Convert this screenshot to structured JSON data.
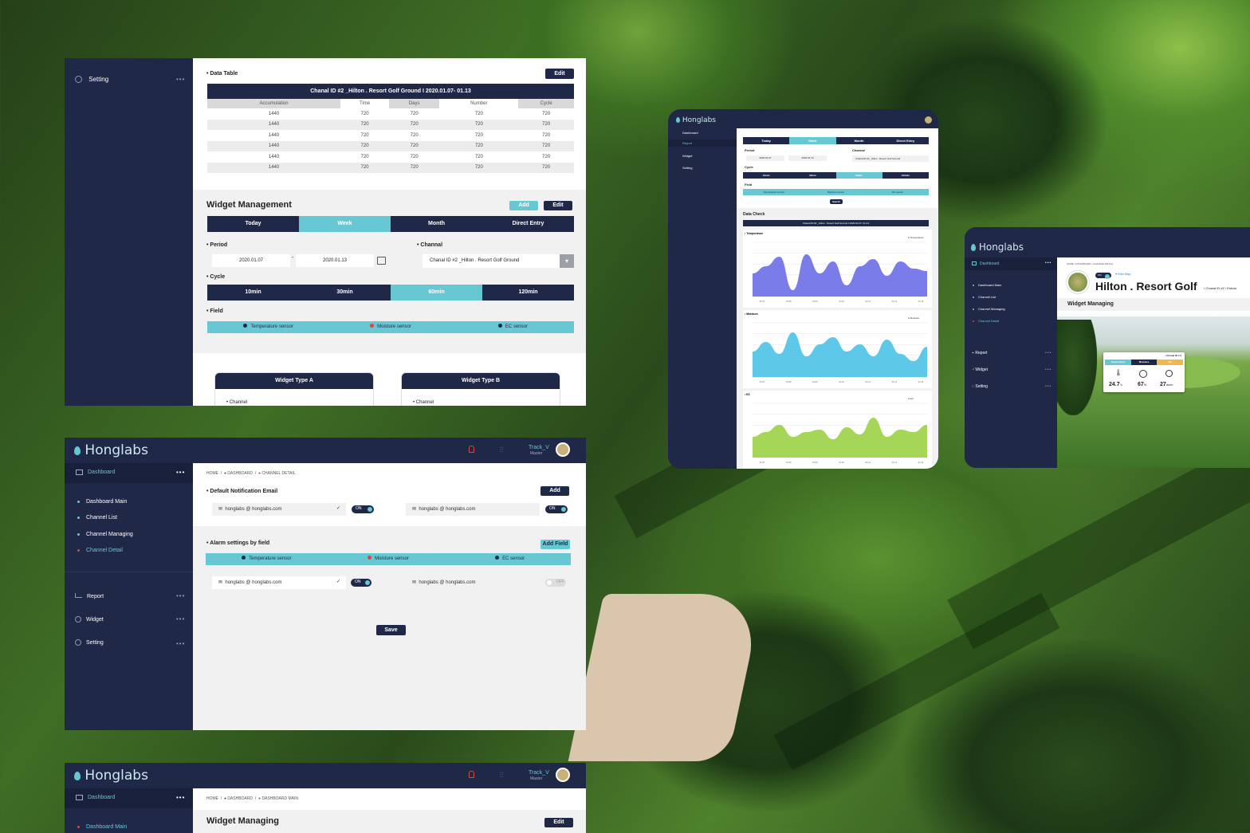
{
  "background": {
    "description_colors": [
      "#2b4a1b",
      "#5b9230"
    ]
  },
  "colors": {
    "navy": "#1f2847",
    "teal": "#67c7d3",
    "red": "#e2443c",
    "chart_purple": "#6b6ee8",
    "chart_blue": "#4cc2e6",
    "chart_green": "#9bd146"
  },
  "panel1": {
    "sidebar_setting": "Setting",
    "data_table_label": "Data Table",
    "edit": "Edit",
    "table_title": "Chanal ID #2 _Hilton . Resort Golf Ground  I    2020.01.07- 01.13",
    "columns": [
      "Accumulation",
      "Time",
      "Days",
      "Number",
      "Cycle"
    ],
    "rows": [
      [
        "1440",
        "720",
        "720",
        "720",
        "720"
      ],
      [
        "1440",
        "720",
        "720",
        "720",
        "720"
      ],
      [
        "1440",
        "720",
        "720",
        "720",
        "720"
      ],
      [
        "1440",
        "720",
        "720",
        "720",
        "720"
      ],
      [
        "1440",
        "720",
        "720",
        "720",
        "720"
      ],
      [
        "1440",
        "720",
        "720",
        "720",
        "720"
      ]
    ],
    "widget_mgmt_title": "Widget Management",
    "add": "Add",
    "edit2": "Edit",
    "period_tabs": [
      "Today",
      "Week",
      "Month",
      "Direct Entry"
    ],
    "period_label": "Period",
    "date_from": "2020.01.07",
    "date_to": "2020.01.13",
    "channel_label": "Channal",
    "channel_value": "Chanal ID #2 _Hilton . Resort Golf Ground",
    "cycle_label": "Cycle",
    "cycles": [
      "10min",
      "30min",
      "60min",
      "120min"
    ],
    "field_label": "Field",
    "fields": [
      "Temperature sensor",
      "Moisture sensor",
      "EC sensor"
    ],
    "widget_a": "Widget Type A",
    "widget_b": "Widget Type B",
    "channel_bullet": "Channel"
  },
  "panel2": {
    "logo": "Honglabs",
    "user": "Track_V",
    "role": "Master",
    "nav": {
      "dashboard": "Dashboard",
      "items": [
        "Dashboard Main",
        "Channel List",
        "Channel Managing",
        "Channel Detail"
      ],
      "report": "Report",
      "widget": "Widget",
      "setting": "Setting"
    },
    "breadcrumb": [
      "HOME",
      "DASHBOARD",
      "CHANNEL DETAIL"
    ],
    "notif_title": "Default Notification Email",
    "add": "Add",
    "email": "honglabs @ honglabs.com",
    "on": "ON",
    "off": "OFF",
    "alarm_title": "Alarm settings by field",
    "add_field": "Add Field",
    "fields": [
      "Temperature sensor",
      "Moisture sensor",
      "EC sensor"
    ],
    "save": "Save"
  },
  "panel3": {
    "logo": "Honglabs",
    "user": "Track_V",
    "role": "Master",
    "dashboard": "Dashboard",
    "dashboard_main": "Dashboard Main",
    "breadcrumb": [
      "HOME",
      "DASHBOARD",
      "DASHBOARD MAIN"
    ],
    "title": "Widget Managing",
    "edit": "Edit"
  },
  "tablet1": {
    "logo": "Honglabs",
    "nav": [
      "Dashboard",
      "Report",
      "Widget",
      "Setting"
    ],
    "tabs": [
      "Today",
      "Week",
      "Month",
      "Direct Entry"
    ],
    "period": "Period",
    "channel": "Channal",
    "date_from": "2020.01.07",
    "date_to": "2020.01.13",
    "channel_value": "Chanal ID #2 _Hilton . Resort Golf Ground",
    "cycle": "Cycle",
    "cycles": [
      "10min",
      "30min",
      "60min",
      "120min"
    ],
    "field": "Field",
    "fields": [
      "Temperature sensor",
      "Moisture sensor",
      "EC sensor"
    ],
    "search": "Search",
    "data_check": "Data Check",
    "data_title": "Chanal ID #2 _Hilton . Resort Golf Ground  I   2020.01.07- 01.13",
    "charts": [
      {
        "label": "Temperature",
        "legend": "Temperature"
      },
      {
        "label": "Moisture",
        "legend": "Moisture"
      },
      {
        "label": "EC",
        "legend": "EC"
      }
    ],
    "x_ticks": [
      "01.07",
      "01.08",
      "01.09",
      "01.10",
      "01.11",
      "01.12",
      "01.13"
    ]
  },
  "tablet2": {
    "logo": "Honglabs",
    "nav": {
      "dashboard": "Dashboard",
      "items": [
        "Dashboard Main",
        "Channel List",
        "Channel Managing",
        "Channel Detail"
      ],
      "report": "Report",
      "widget": "Widget",
      "setting": "Setting"
    },
    "breadcrumb": [
      "HOME",
      "DASHBOARD",
      "CHANNEL DETAIL"
    ],
    "on": "ON",
    "mini_map": "Mini Map",
    "title": "Hilton . Resort Golf",
    "channel_tag": "Chanal ID #2",
    "entrance": "Entran",
    "widget_managing": "Widget Managing",
    "widget": {
      "channel": "Chanal ID # 2",
      "tabs": [
        "Temperature",
        "Moisture",
        "EC"
      ],
      "temp": "24.7",
      "temp_unit": "°c",
      "moisture": "67",
      "moisture_unit": "%",
      "ec": "27",
      "ec_unit": "ds/m"
    }
  }
}
